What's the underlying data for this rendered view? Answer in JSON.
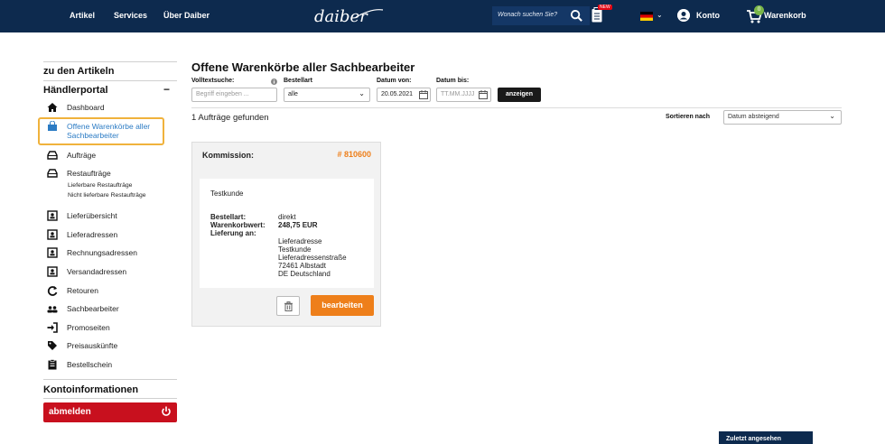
{
  "header": {
    "nav": [
      "Artikel",
      "Services",
      "Über Daiber"
    ],
    "logo_text": "daiber",
    "search_placeholder": "Wonach suchen Sie?",
    "new_badge": "NEW",
    "account": "Konto",
    "cart": "Warenkorb",
    "cart_count": "0",
    "colors": {
      "bar": "#0d2a4e",
      "accent": "#ee7f1a"
    }
  },
  "sidebar": {
    "back": "zu den Artikeln",
    "section": "Händlerportal",
    "collapse": "−",
    "items": [
      {
        "label": "Dashboard",
        "icon": "home-icon"
      },
      {
        "label": "Offene Warenkörbe aller",
        "label2": "Sachbearbeiter",
        "icon": "shopping-bag-icon"
      },
      {
        "label": "Aufträge",
        "icon": "inbox-icon"
      },
      {
        "label": "Restaufträge",
        "icon": "inbox-icon"
      },
      {
        "label": "Lieferübersicht",
        "icon": "contact-card-icon"
      },
      {
        "label": "Lieferadressen",
        "icon": "contact-card-icon"
      },
      {
        "label": "Rechnungsadressen",
        "icon": "contact-card-icon"
      },
      {
        "label": "Versandadressen",
        "icon": "contact-card-icon"
      },
      {
        "label": "Retouren",
        "icon": "return-arrow-icon"
      },
      {
        "label": "Sachbearbeiter",
        "icon": "users-icon"
      },
      {
        "label": "Promoseiten",
        "icon": "sign-in-icon"
      },
      {
        "label": "Preisauskünfte",
        "icon": "tag-icon"
      },
      {
        "label": "Bestellschein",
        "icon": "clipboard-icon"
      }
    ],
    "sub_items": [
      "Lieferbare Restaufträge",
      "Nicht lieferbare Restaufträge"
    ],
    "account_info": "Kontoinformationen",
    "logout": "abmelden"
  },
  "main": {
    "title": "Offene Warenkörbe aller Sachbearbeiter",
    "filters": {
      "search_label": "Volltextsuche:",
      "search_placeholder": "Begriff eingeben ...",
      "type_label": "Bestellart",
      "type_value": "alle",
      "from_label": "Datum von:",
      "from_value": "20.05.2021",
      "to_label": "Datum bis:",
      "to_placeholder": "TT.MM.JJJJ",
      "show_button": "anzeigen"
    },
    "result_count": "1 Aufträge gefunden",
    "sort_label": "Sortieren nach",
    "sort_value": "Datum absteigend",
    "order": {
      "commission_label": "Kommission:",
      "number": "# 810600",
      "customer": "Testkunde",
      "type_label": "Bestellart:",
      "type_value": "direkt",
      "value_label": "Warenkorbwert:",
      "value": "248,75 EUR",
      "delivery_label": "Lieferung an:",
      "address": [
        "Lieferadresse",
        "Testkunde",
        "Lieferadressenstraße",
        "72461 Albstadt",
        "DE Deutschland"
      ],
      "edit_button": "bearbeiten"
    }
  },
  "recently_viewed": "Zuletzt angesehen"
}
